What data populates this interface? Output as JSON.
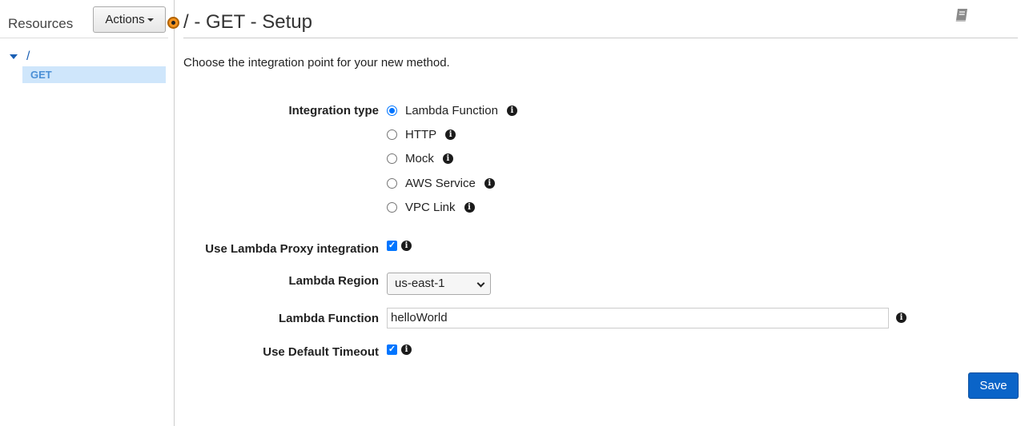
{
  "sidebar": {
    "title": "Resources",
    "actions_label": "Actions",
    "tree": {
      "root_label": "/",
      "method_label": "GET"
    }
  },
  "main": {
    "title": "/ - GET - Setup",
    "subtitle": "Choose the integration point for your new method.",
    "integration_type": {
      "label": "Integration type",
      "options": [
        {
          "label": "Lambda Function",
          "selected": true
        },
        {
          "label": "HTTP",
          "selected": false
        },
        {
          "label": "Mock",
          "selected": false
        },
        {
          "label": "AWS Service",
          "selected": false
        },
        {
          "label": "VPC Link",
          "selected": false
        }
      ]
    },
    "proxy": {
      "label": "Use Lambda Proxy integration",
      "checked": true
    },
    "region": {
      "label": "Lambda Region",
      "value": "us-east-1"
    },
    "function": {
      "label": "Lambda Function",
      "value": "helloWorld"
    },
    "timeout": {
      "label": "Use Default Timeout",
      "checked": true
    },
    "save_label": "Save"
  },
  "icons": {
    "info": "i",
    "check": "✓",
    "book": "book-icon"
  },
  "colors": {
    "accent": "#0075ff",
    "save_button": "#0a64c8",
    "tree_link": "#1a5fb4",
    "selected_row": "#cfe6fb",
    "handle": "#f7941d"
  }
}
